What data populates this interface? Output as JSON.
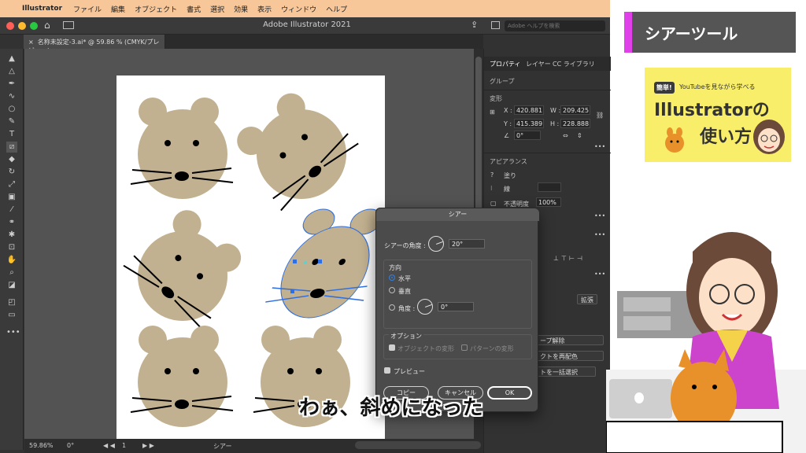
{
  "menubar": {
    "app": "Illustrator",
    "items": [
      "ファイル",
      "編集",
      "オブジェクト",
      "書式",
      "選択",
      "効果",
      "表示",
      "ウィンドウ",
      "ヘルプ"
    ]
  },
  "window": {
    "title": "Adobe Illustrator 2021",
    "search_placeholder": "Adobe ヘルプを検索",
    "document_tab": "名称未設定-3.ai* @ 59.86 % (CMYK/プレビュー)"
  },
  "statusbar": {
    "zoom": "59.86%",
    "rotation": "0°",
    "page": "1",
    "tool": "シアー"
  },
  "panel": {
    "tabs": [
      "プロパティ",
      "レイヤー",
      "CC ライブラリ"
    ],
    "group_label": "グループ",
    "transform_label": "変形",
    "x_label": "X :",
    "x_value": "420.881",
    "y_label": "Y :",
    "y_value": "415.389",
    "w_label": "W :",
    "w_value": "209.425",
    "h_label": "H :",
    "h_value": "228.888",
    "angle_value": "0°",
    "appearance_label": "アピアランス",
    "fill_label": "塗り",
    "stroke_label": "線",
    "opacity_label": "不透明度",
    "opacity_value": "100%",
    "expand_button": "拡張",
    "ungroup_button": "ープ解除",
    "recolor_button": "クトを再配色",
    "select_same_button": "トを一括選択"
  },
  "dialog": {
    "title": "シアー",
    "angle_label": "シアーの角度 :",
    "angle_value": "20°",
    "direction_label": "方向",
    "horizontal": "水平",
    "vertical": "垂直",
    "angle_radio_label": "角度 :",
    "axis_angle_value": "0°",
    "options_label": "オプション",
    "transform_objects": "オブジェクトの変形",
    "transform_patterns": "パターンの変形",
    "preview": "プレビュー",
    "copy_button": "コピー",
    "cancel_button": "キャンセル",
    "ok_button": "OK"
  },
  "promo": {
    "header": "シアーツール",
    "badge": "簡単!",
    "subtitle": "YouTubeを見ながら学べる",
    "title_line1": "Illustratorの",
    "title_line2": "使い方"
  },
  "caption": "わぁ、斜めになった",
  "colors": {
    "mouse_fill": "#c2b190",
    "selection": "#2f6fe0",
    "menubar": "#f7c79a",
    "promo_accent": "#e040e8",
    "promo_card": "#f8ee6a"
  }
}
